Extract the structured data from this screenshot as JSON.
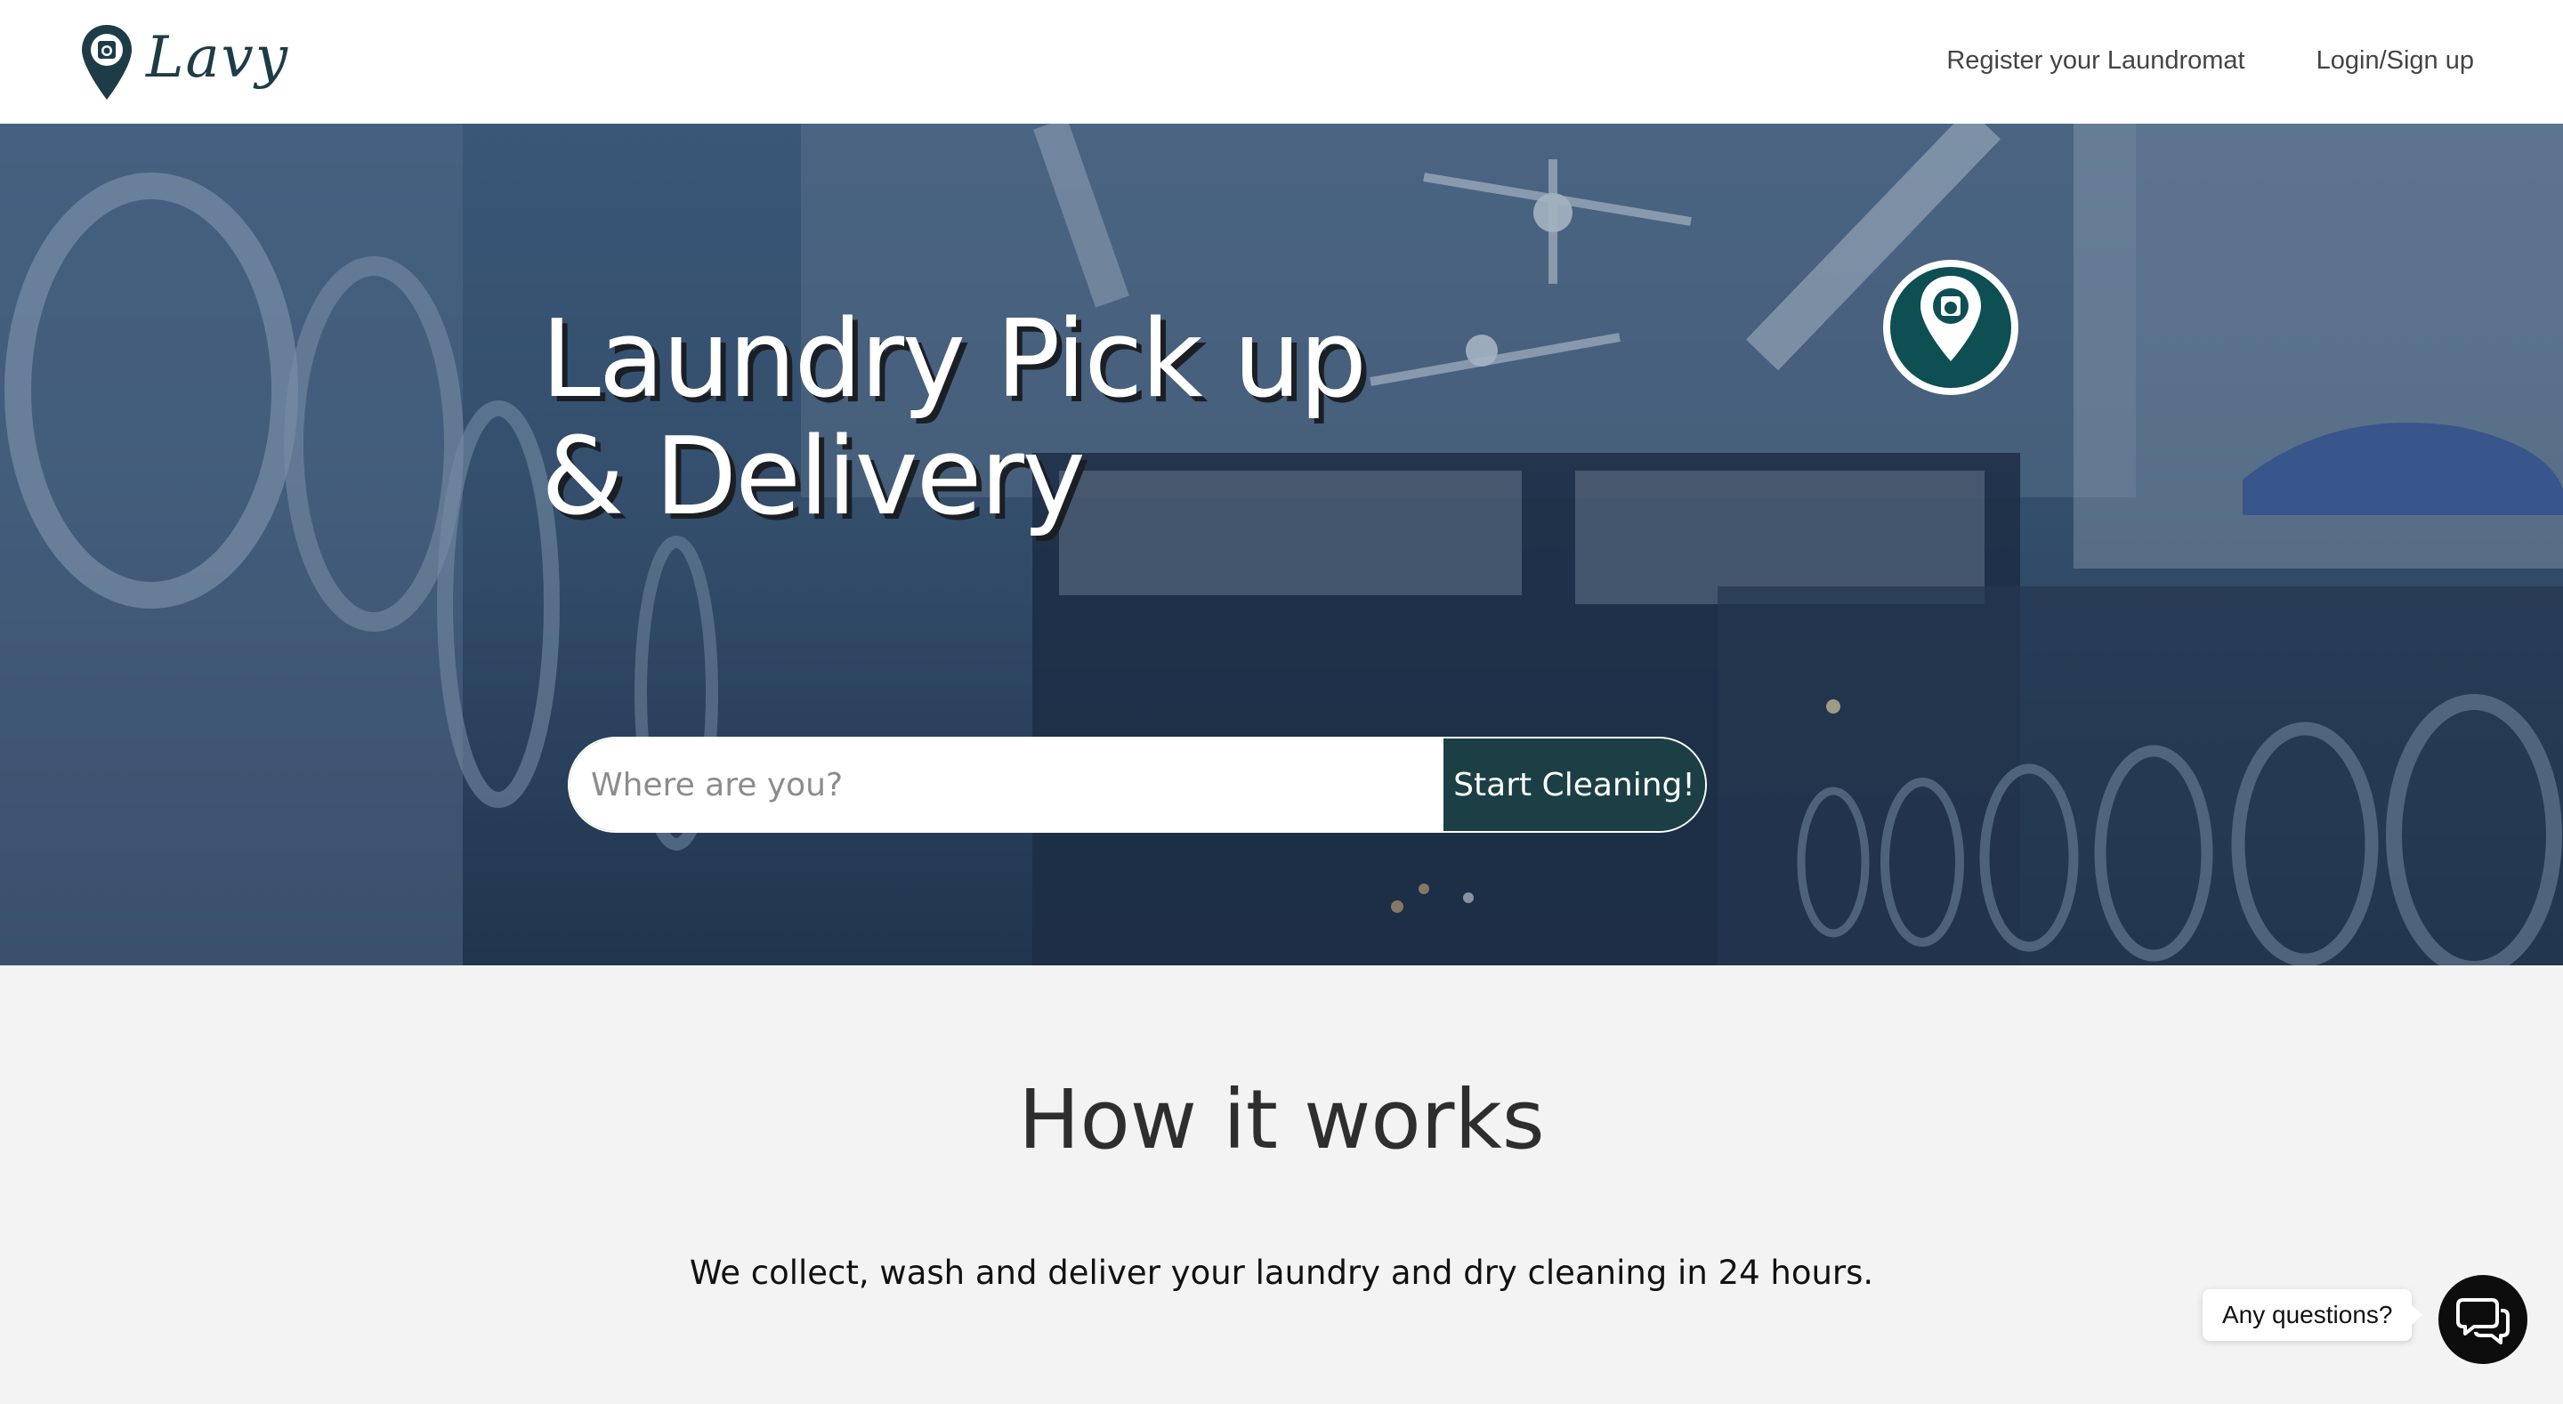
{
  "header": {
    "logo_text": "Lavy",
    "nav": [
      {
        "label": "Register your Laundromat"
      },
      {
        "label": "Login/Sign up"
      }
    ]
  },
  "hero": {
    "title_line1": "Laundry Pick up",
    "title_line2": "& Delivery",
    "search": {
      "placeholder": "Where are you?",
      "value": "",
      "button_label": "Start Cleaning!"
    }
  },
  "how_it_works": {
    "title": "How it works",
    "description": "We collect, wash and deliver your laundry and dry cleaning in 24 hours."
  },
  "chat": {
    "label": "Any questions?"
  },
  "icons": {
    "logo": "map-pin-washer-icon",
    "badge": "map-pin-washer-icon",
    "chat": "chat-bubbles-icon"
  },
  "colors": {
    "brand_dark": "#1d3c47",
    "button_bg": "#1b3f45",
    "hero_overlay": "#3f5c7d",
    "section_bg": "#f3f3f3",
    "chat_button": "#0d0d0d"
  }
}
